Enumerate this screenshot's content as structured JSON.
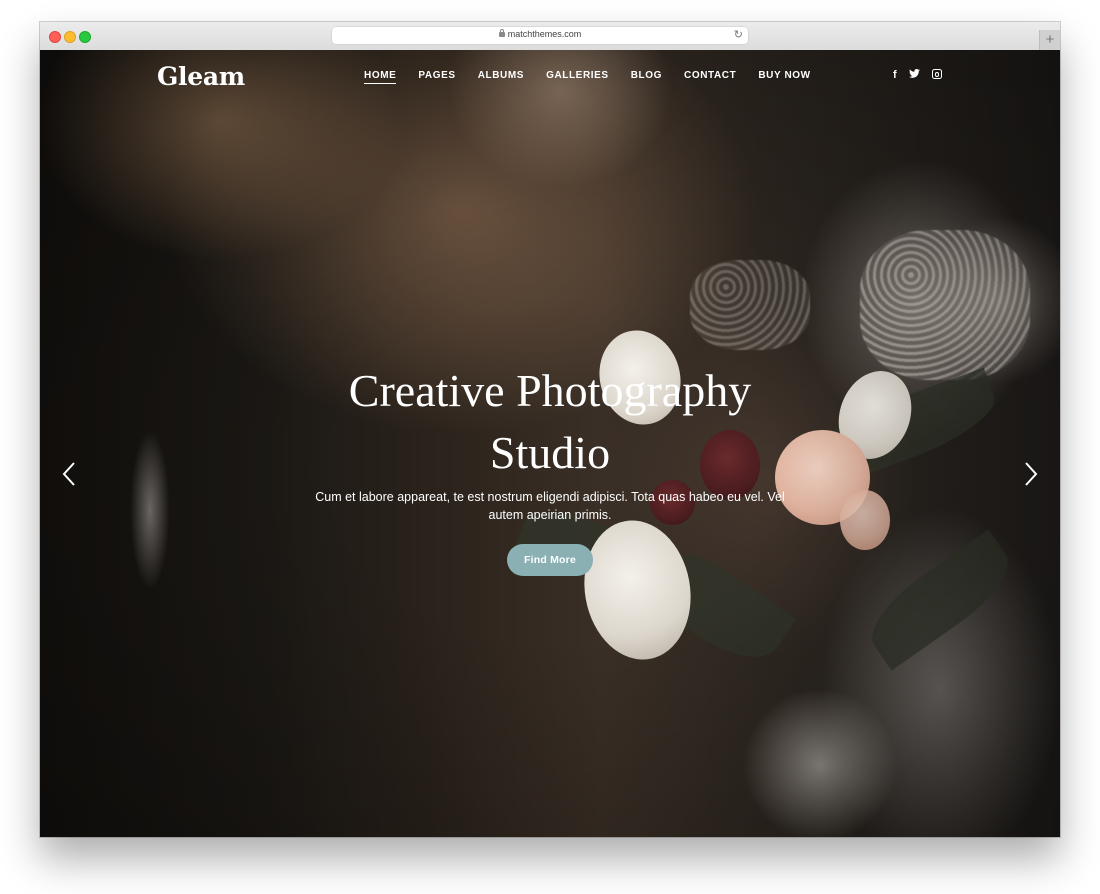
{
  "browser": {
    "url": "matchthemes.com",
    "new_tab_symbol": "+"
  },
  "site": {
    "logo": "Gleam",
    "nav": [
      {
        "label": "HOME",
        "active": true
      },
      {
        "label": "PAGES",
        "active": false
      },
      {
        "label": "ALBUMS",
        "active": false
      },
      {
        "label": "GALLERIES",
        "active": false
      },
      {
        "label": "BLOG",
        "active": false
      },
      {
        "label": "CONTACT",
        "active": false
      },
      {
        "label": "BUY NOW",
        "active": false
      }
    ],
    "social_icons": [
      "facebook-icon",
      "twitter-icon",
      "instagram-icon"
    ],
    "social_glyphs": {
      "facebook": "f",
      "twitter": "🐦"
    }
  },
  "hero": {
    "headline_line1": "Creative Photography",
    "headline_line2": "Studio",
    "subtext": "Cum et labore appareat, te est nostrum eligendi adipisci. Tota quas habeo eu vel. Vel autem apeirian primis.",
    "cta_label": "Find More",
    "prev_icon": "chevron-left-icon",
    "next_icon": "chevron-right-icon"
  },
  "colors": {
    "cta_background": "#8ab0b3",
    "text": "#ffffff"
  }
}
